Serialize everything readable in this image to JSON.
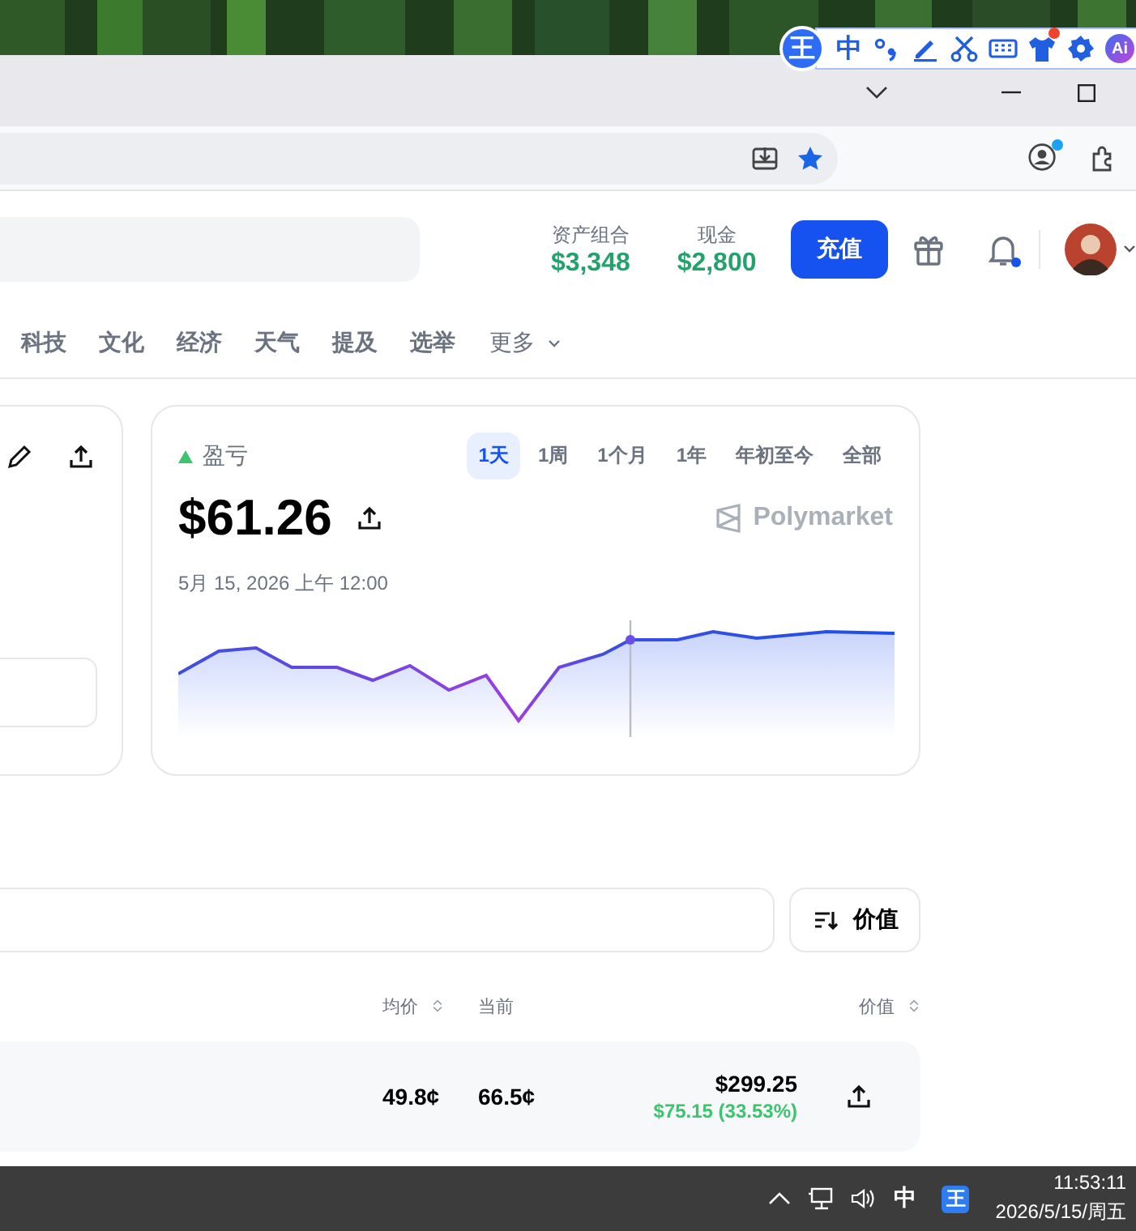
{
  "ime_toolbar": {
    "logo": "王",
    "mode": "中",
    "ai": "Ai",
    "skin_badge": true
  },
  "header": {
    "portfolio": {
      "label": "资产组合",
      "value": "$3,348"
    },
    "cash": {
      "label": "现金",
      "value": "$2,800"
    },
    "deposit_button": "充值",
    "notifications": {
      "unread": true
    }
  },
  "categories": [
    {
      "label": "科技"
    },
    {
      "label": "文化"
    },
    {
      "label": "经济"
    },
    {
      "label": "天气"
    },
    {
      "label": "提及"
    },
    {
      "label": "选举"
    }
  ],
  "more": "更多",
  "pnl_card": {
    "label": "盈亏",
    "gain": true,
    "value": "$61.26",
    "timestamp": "5月 15, 2026 上午 12:00",
    "brand": "Polymarket",
    "ranges": [
      {
        "label": "1天",
        "selected": true
      },
      {
        "label": "1周",
        "selected": false
      },
      {
        "label": "1个月",
        "selected": false
      },
      {
        "label": "1年",
        "selected": false
      },
      {
        "label": "年初至今",
        "selected": false
      },
      {
        "label": "全部",
        "selected": false
      }
    ]
  },
  "positions": {
    "sort_button": "价值",
    "columns": [
      {
        "label": "均价",
        "sortable": true
      },
      {
        "label": "当前",
        "sortable": false
      },
      {
        "label": "价值",
        "sortable": true
      }
    ],
    "rows": [
      {
        "avg": "49.8¢",
        "current": "66.5¢",
        "value": "$299.25",
        "change": "$75.15 (33.53%)",
        "gain": true
      }
    ]
  },
  "taskbar": {
    "ime_mode": "中",
    "ime_logo": "王",
    "time": "11:53:11",
    "date": "2026/5/15/周五"
  }
}
